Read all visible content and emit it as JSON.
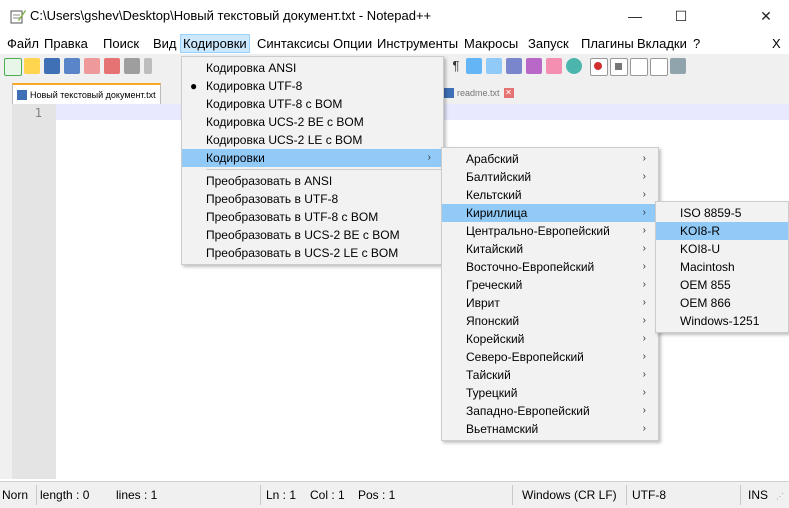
{
  "window": {
    "title": "C:\\Users\\gshev\\Desktop\\Новый текстовый документ.txt - Notepad++",
    "minimize": "—",
    "maximize": "☐",
    "close": "✕"
  },
  "menubar": {
    "items": [
      "Файл",
      "Правка",
      "Поиск",
      "Вид",
      "Кодировки",
      "Синтаксисы",
      "Опции",
      "Инструменты",
      "Макросы",
      "Запуск",
      "Плагины",
      "Вкладки",
      "?"
    ],
    "close_x": "X",
    "active": "Кодировки"
  },
  "tabs": [
    {
      "label": "Новый текстовый документ.txt"
    },
    {
      "label": "readme.txt"
    }
  ],
  "editor": {
    "line_number": "1"
  },
  "encoding_menu": {
    "items": [
      "Кодировка ANSI",
      "Кодировка UTF-8",
      "Кодировка UTF-8 с BOM",
      "Кодировка UCS-2 BE с BOM",
      "Кодировка UCS-2 LE с BOM",
      "Кодировки"
    ],
    "checked": "Кодировка UTF-8",
    "checked_mark": "●",
    "convert_items": [
      "Преобразовать в ANSI",
      "Преобразовать в UTF-8",
      "Преобразовать в UTF-8 с BOM",
      "Преобразовать в UCS-2 BE с BOM",
      "Преобразовать в UCS-2 LE с BOM"
    ]
  },
  "charset_menu": {
    "items": [
      "Арабский",
      "Балтийский",
      "Кельтский",
      "Кириллица",
      "Центрально-Европейский",
      "Китайский",
      "Восточно-Европейский",
      "Греческий",
      "Иврит",
      "Японский",
      "Корейский",
      "Северо-Европейский",
      "Тайский",
      "Турецкий",
      "Западно-Европейский",
      "Вьетнамский"
    ],
    "highlighted": "Кириллица"
  },
  "cyrillic_menu": {
    "items": [
      "ISO 8859-5",
      "KOI8-R",
      "KOI8-U",
      "Macintosh",
      "OEM 855",
      "OEM 866",
      "Windows-1251"
    ],
    "highlighted": "KOI8-R"
  },
  "arrow": "›",
  "statusbar": {
    "type": "Norn",
    "length": "length : 0",
    "lines": "lines : 1",
    "ln": "Ln : 1",
    "col": "Col : 1",
    "pos": "Pos : 1",
    "eol": "Windows (CR LF)",
    "encoding": "UTF-8",
    "mode": "INS"
  },
  "colors": {
    "menu_highlight": "#91c9f7",
    "active_menu": "#cce8ff",
    "current_line": "#e8e8ff"
  }
}
